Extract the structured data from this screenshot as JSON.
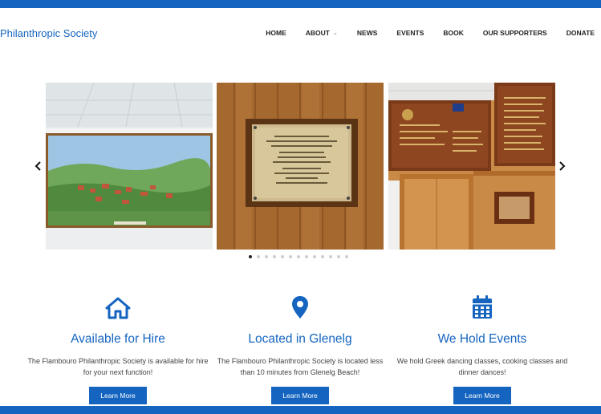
{
  "brand": {
    "title": "Philanthropic Society"
  },
  "nav": {
    "items": [
      {
        "label": "HOME"
      },
      {
        "label": "ABOUT",
        "has_dropdown": true
      },
      {
        "label": "NEWS"
      },
      {
        "label": "EVENTS"
      },
      {
        "label": "BOOK"
      },
      {
        "label": "OUR SUPPORTERS"
      },
      {
        "label": "DONATE"
      }
    ]
  },
  "carousel": {
    "slides": [
      {
        "subject": "painting-of-village"
      },
      {
        "subject": "commemorative-plaque",
        "plaque_text": "THE FLAMBOURON PHILANTHROPIC SOCIETY OF S.A. INC. (EST. 1957) THE FLAMBOURON HALL WAS OFFICIALLY OPENED BY G. KOUNTOUREAS THE CONSUL GENERAL OF GREECE ON THIS DAY THE 18TH FEBRUARY 1961"
      },
      {
        "subject": "honour-boards"
      }
    ],
    "dot_count": 13,
    "active_dot": 0
  },
  "features": [
    {
      "icon": "home-icon",
      "title": "Available for Hire",
      "text": "The Flambouro Philanthropic Society is available for hire for your next function!",
      "button": "Learn More"
    },
    {
      "icon": "map-pin-icon",
      "title": "Located in Glenelg",
      "text": "The Flambouro Philanthropic Society is located less than 10 minutes from Glenelg Beach!",
      "button": "Learn More"
    },
    {
      "icon": "calendar-icon",
      "title": "We Hold Events",
      "text": "We hold Greek dancing classes, cooking classes and dinner dances!",
      "button": "Learn More"
    }
  ],
  "colors": {
    "brand": "#1565c0",
    "text": "#333333"
  }
}
